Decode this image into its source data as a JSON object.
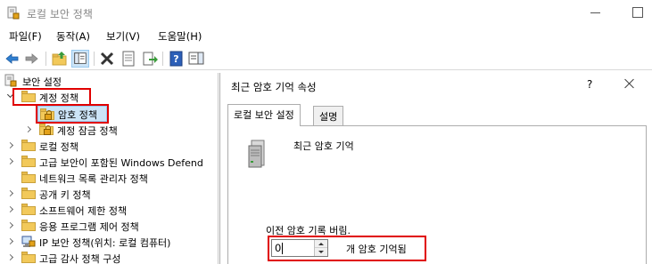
{
  "window": {
    "title": "로컬 보안 정책"
  },
  "menu": [
    "파일(F)",
    "동작(A)",
    "보기(V)",
    "도움말(H)"
  ],
  "toolbar": [
    "back-icon",
    "forward-icon",
    "up-folder-icon",
    "show-hide-tree-icon",
    "delete-icon",
    "properties-icon",
    "export-icon",
    "help-icon",
    "action-pane-icon"
  ],
  "tree": {
    "root": "보안 설정",
    "items": [
      {
        "label": "계정 정책",
        "state": "expanded",
        "icon": "folder-icon",
        "highlight": true
      },
      {
        "label": "암호 정책",
        "state": "collapsed",
        "icon": "locked-folder-icon",
        "selected": true,
        "highlight": true
      },
      {
        "label": "계정 잠금 정책",
        "state": "collapsed",
        "icon": "locked-folder-icon"
      },
      {
        "label": "로컬 정책",
        "state": "collapsed",
        "icon": "folder-icon"
      },
      {
        "label": "고급 보안이 포함된 Windows Defend",
        "state": "collapsed",
        "icon": "folder-icon"
      },
      {
        "label": "네트워크 목록 관리자 정책",
        "state": "none",
        "icon": "folder-icon"
      },
      {
        "label": "공개 키 정책",
        "state": "collapsed",
        "icon": "folder-icon"
      },
      {
        "label": "소프트웨어 제한 정책",
        "state": "collapsed",
        "icon": "folder-icon"
      },
      {
        "label": "응용 프로그램 제어 정책",
        "state": "collapsed",
        "icon": "folder-icon"
      },
      {
        "label": "IP 보안 정책(위치: 로컬 컴퓨터)",
        "state": "collapsed",
        "icon": "ip-security-icon"
      },
      {
        "label": "고급 감사 정책 구성",
        "state": "collapsed",
        "icon": "folder-icon"
      }
    ]
  },
  "dialog": {
    "title": "최근 암호 기억 속성",
    "help": "?",
    "tabs": [
      "로컬 보안 설정",
      "설명"
    ],
    "active_tab": 0,
    "policy_name": "최근 암호 기억",
    "field_label": "이전 암호 기록 버림.",
    "value": "0",
    "unit": "개 암호 기억됨"
  },
  "colors": {
    "highlight": "#e00000",
    "selection": "#cce4f7",
    "folder": "#f2c95a"
  }
}
